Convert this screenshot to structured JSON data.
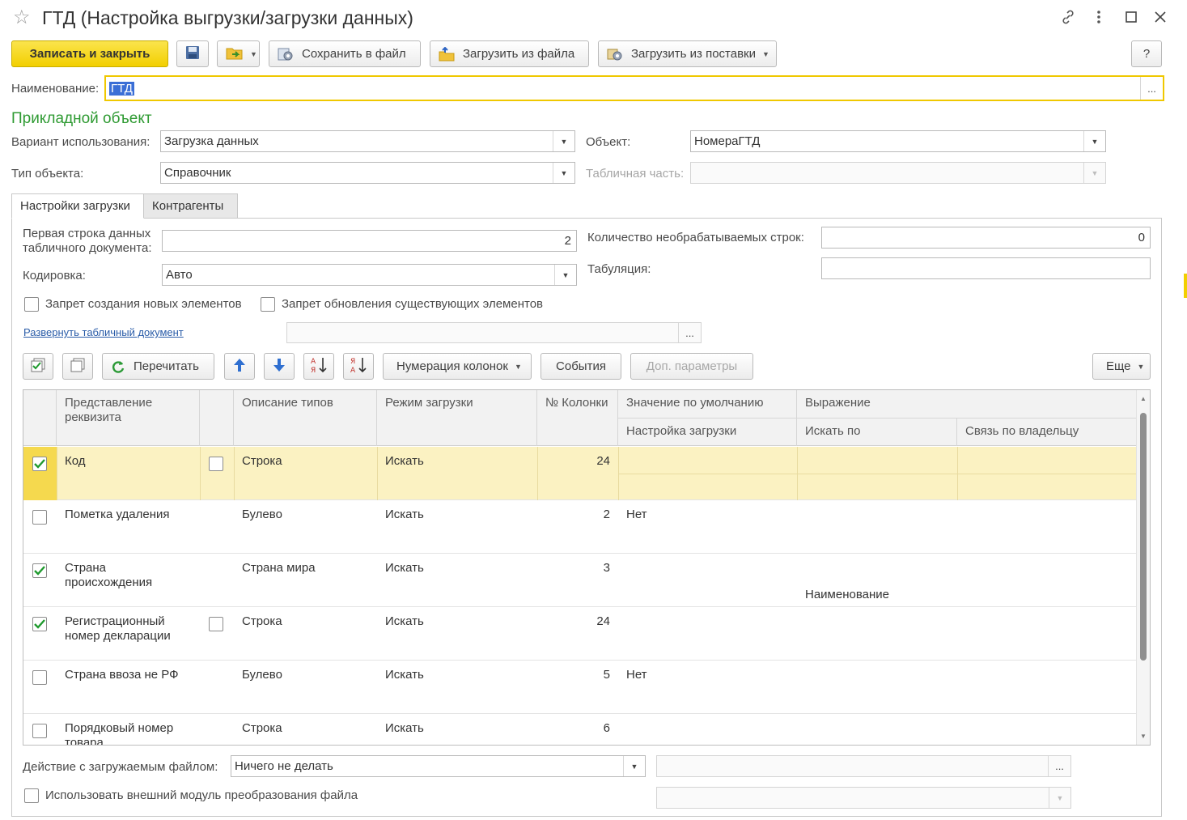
{
  "window": {
    "title": "ГТД (Настройка выгрузки/загрузки данных)"
  },
  "toolbar": {
    "save_close": "Записать и закрыть",
    "save_to_file": "Сохранить в файл",
    "load_from_file": "Загрузить из файла",
    "load_from_supply": "Загрузить из поставки",
    "help": "?"
  },
  "name_field": {
    "label": "Наименование:",
    "value": "ГТД"
  },
  "section": {
    "title": "Прикладной объект"
  },
  "usage": {
    "label": "Вариант использования:",
    "value": "Загрузка данных"
  },
  "object_type": {
    "label": "Тип объекта:",
    "value": "Справочник"
  },
  "object": {
    "label": "Объект:",
    "value": "НомераГТД"
  },
  "tabular_part": {
    "label": "Табличная часть:",
    "value": ""
  },
  "tabs": [
    {
      "label": "Настройки загрузки",
      "active": true
    },
    {
      "label": "Контрагенты",
      "active": false
    }
  ],
  "settings": {
    "first_row_label_1": "Первая строка данных",
    "first_row_label_2": "табличного документа:",
    "first_row_value": "2",
    "encoding_label": "Кодировка:",
    "encoding_value": "Авто",
    "skip_rows_label": "Количество необрабатываемых строк:",
    "skip_rows_value": "0",
    "tab_label": "Табуляция:",
    "tab_value": "",
    "forbid_create": "Запрет создания новых элементов",
    "forbid_update": "Запрет обновления существующих элементов",
    "expand_link": "Развернуть табличный документ"
  },
  "table_toolbar": {
    "reread": "Перечитать",
    "col_numbering": "Нумерация колонок",
    "events": "События",
    "extra_params": "Доп. параметры",
    "more": "Еще"
  },
  "table": {
    "headers": {
      "representation_1": "Представление",
      "representation_2": "реквизита",
      "type_desc": "Описание типов",
      "load_mode": "Режим загрузки",
      "col_no": "№ Колонки",
      "default_value": "Значение по умолчанию",
      "expression": "Выражение",
      "load_setting": "Настройка загрузки",
      "search_by": "Искать по",
      "owner_link": "Связь по владельцу"
    },
    "rows": [
      {
        "checked": true,
        "name_1": "Код",
        "name_2": "",
        "has_flag": true,
        "type": "Строка",
        "mode": "Искать",
        "col": "24",
        "default": "",
        "search_by": ""
      },
      {
        "checked": false,
        "name_1": "Пометка удаления",
        "name_2": "",
        "has_flag": false,
        "type": "Булево",
        "mode": "Искать",
        "col": "2",
        "default": "Нет",
        "search_by": ""
      },
      {
        "checked": true,
        "name_1": "Страна",
        "name_2": "происхождения",
        "has_flag": false,
        "type": "Страна мира",
        "mode": "Искать",
        "col": "3",
        "default": "",
        "search_by": "Наименование"
      },
      {
        "checked": true,
        "name_1": "Регистрационный",
        "name_2": "номер декларации",
        "has_flag": true,
        "type": "Строка",
        "mode": "Искать",
        "col": "24",
        "default": "",
        "search_by": ""
      },
      {
        "checked": false,
        "name_1": "Страна ввоза не РФ",
        "name_2": "",
        "has_flag": false,
        "type": "Булево",
        "mode": "Искать",
        "col": "5",
        "default": "Нет",
        "search_by": ""
      },
      {
        "checked": false,
        "name_1": "Порядковый номер",
        "name_2": "товара",
        "has_flag": false,
        "type": "Строка",
        "mode": "Искать",
        "col": "6",
        "default": "",
        "search_by": ""
      }
    ]
  },
  "footer": {
    "file_action_label": "Действие с загружаемым файлом:",
    "file_action_value": "Ничего не делать",
    "use_external_module": "Использовать внешний модуль преобразования файла"
  },
  "colors": {
    "accent_yellow": "#f2cf00",
    "section_green": "#2e9a32",
    "selected_row": "#fbf2c2",
    "link_blue": "#2a5ca8"
  }
}
